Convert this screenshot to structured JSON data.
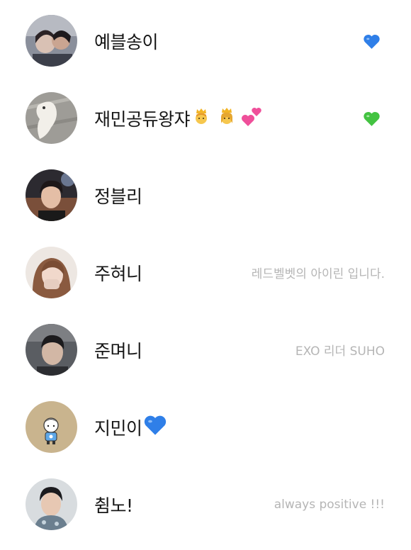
{
  "friends": [
    {
      "name": "예블송이",
      "status": "",
      "heart_color": "#3b82e6",
      "icon": "blue-heart-icon"
    },
    {
      "name": "재민공듀왕쟈",
      "status": "",
      "heart_color": "#43c341",
      "icon": "green-heart-icon",
      "emojis": [
        "prince-emoji-icon",
        "princess-emoji-icon",
        "two-hearts-icon"
      ]
    },
    {
      "name": "정블리",
      "status": ""
    },
    {
      "name": "주혀니",
      "status": "레드벨벳의 아이린 입니다."
    },
    {
      "name": "준며니",
      "status": "EXO 리더 SUHO"
    },
    {
      "name": "지민이",
      "status": "",
      "inline_icon": "blue-heart-icon"
    },
    {
      "name": "췸노!",
      "status": "always positive !!!"
    }
  ],
  "colors": {
    "background": "#ffffff",
    "name_text": "#161616",
    "status_text": "#b5b5b5",
    "blue_heart": "#2f7fe8",
    "green_heart": "#43c341",
    "pink_heart": "#ef4f9a",
    "crown": "#f2b425"
  }
}
